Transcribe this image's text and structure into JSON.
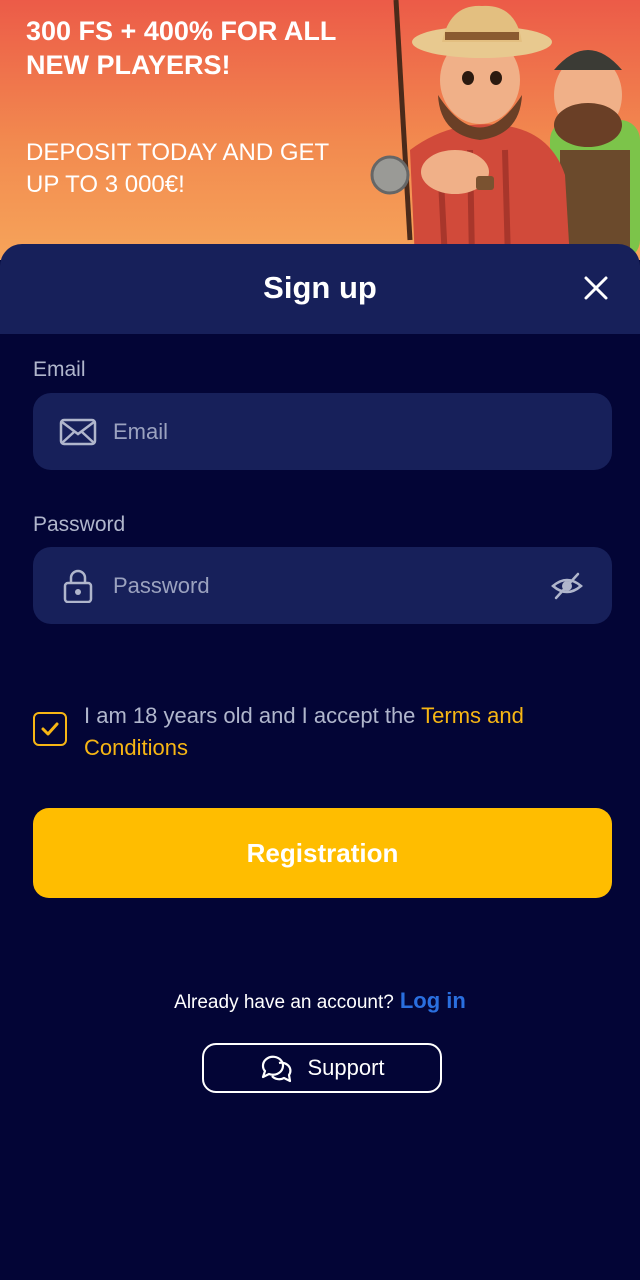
{
  "promo": {
    "headline": "300 FS + 400% FOR ALL NEW PLAYERS!",
    "subtext": "DEPOSIT TODAY AND GET UP TO 3 000€!"
  },
  "modal": {
    "title": "Sign up",
    "close_icon": "close-icon"
  },
  "form": {
    "email": {
      "label": "Email",
      "placeholder": "Email",
      "value": "",
      "icon": "envelope-icon"
    },
    "password": {
      "label": "Password",
      "placeholder": "Password",
      "value": "",
      "icon": "lock-icon",
      "toggle_icon": "eye-off-icon"
    },
    "terms": {
      "checked": true,
      "text": "I am 18 years old and I accept the ",
      "link": "Terms and Conditions"
    },
    "submit_label": "Registration"
  },
  "footer": {
    "login_prompt": "Already have an account?",
    "login_link": "Log in",
    "support_label": "Support",
    "support_icon": "chat-bubbles-icon"
  },
  "colors": {
    "background": "#030536",
    "panel": "#17205a",
    "accent": "#ffbd00",
    "link": "#2a6fdf"
  }
}
